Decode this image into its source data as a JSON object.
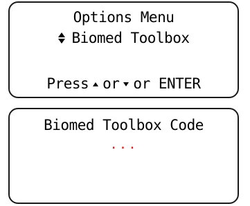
{
  "options_panel": {
    "title": "Options Menu",
    "selection": "Biomed Toolbox",
    "prompt_press": "Press",
    "prompt_or_1": "or",
    "prompt_or_2": "or ENTER",
    "icons": {
      "selection_marker": "up-down-arrows-icon",
      "up": "up-triangle-icon",
      "down": "down-triangle-icon"
    }
  },
  "code_panel": {
    "title": "Biomed Toolbox Code",
    "code_entry": "...",
    "code_color": "#d42a2a"
  }
}
